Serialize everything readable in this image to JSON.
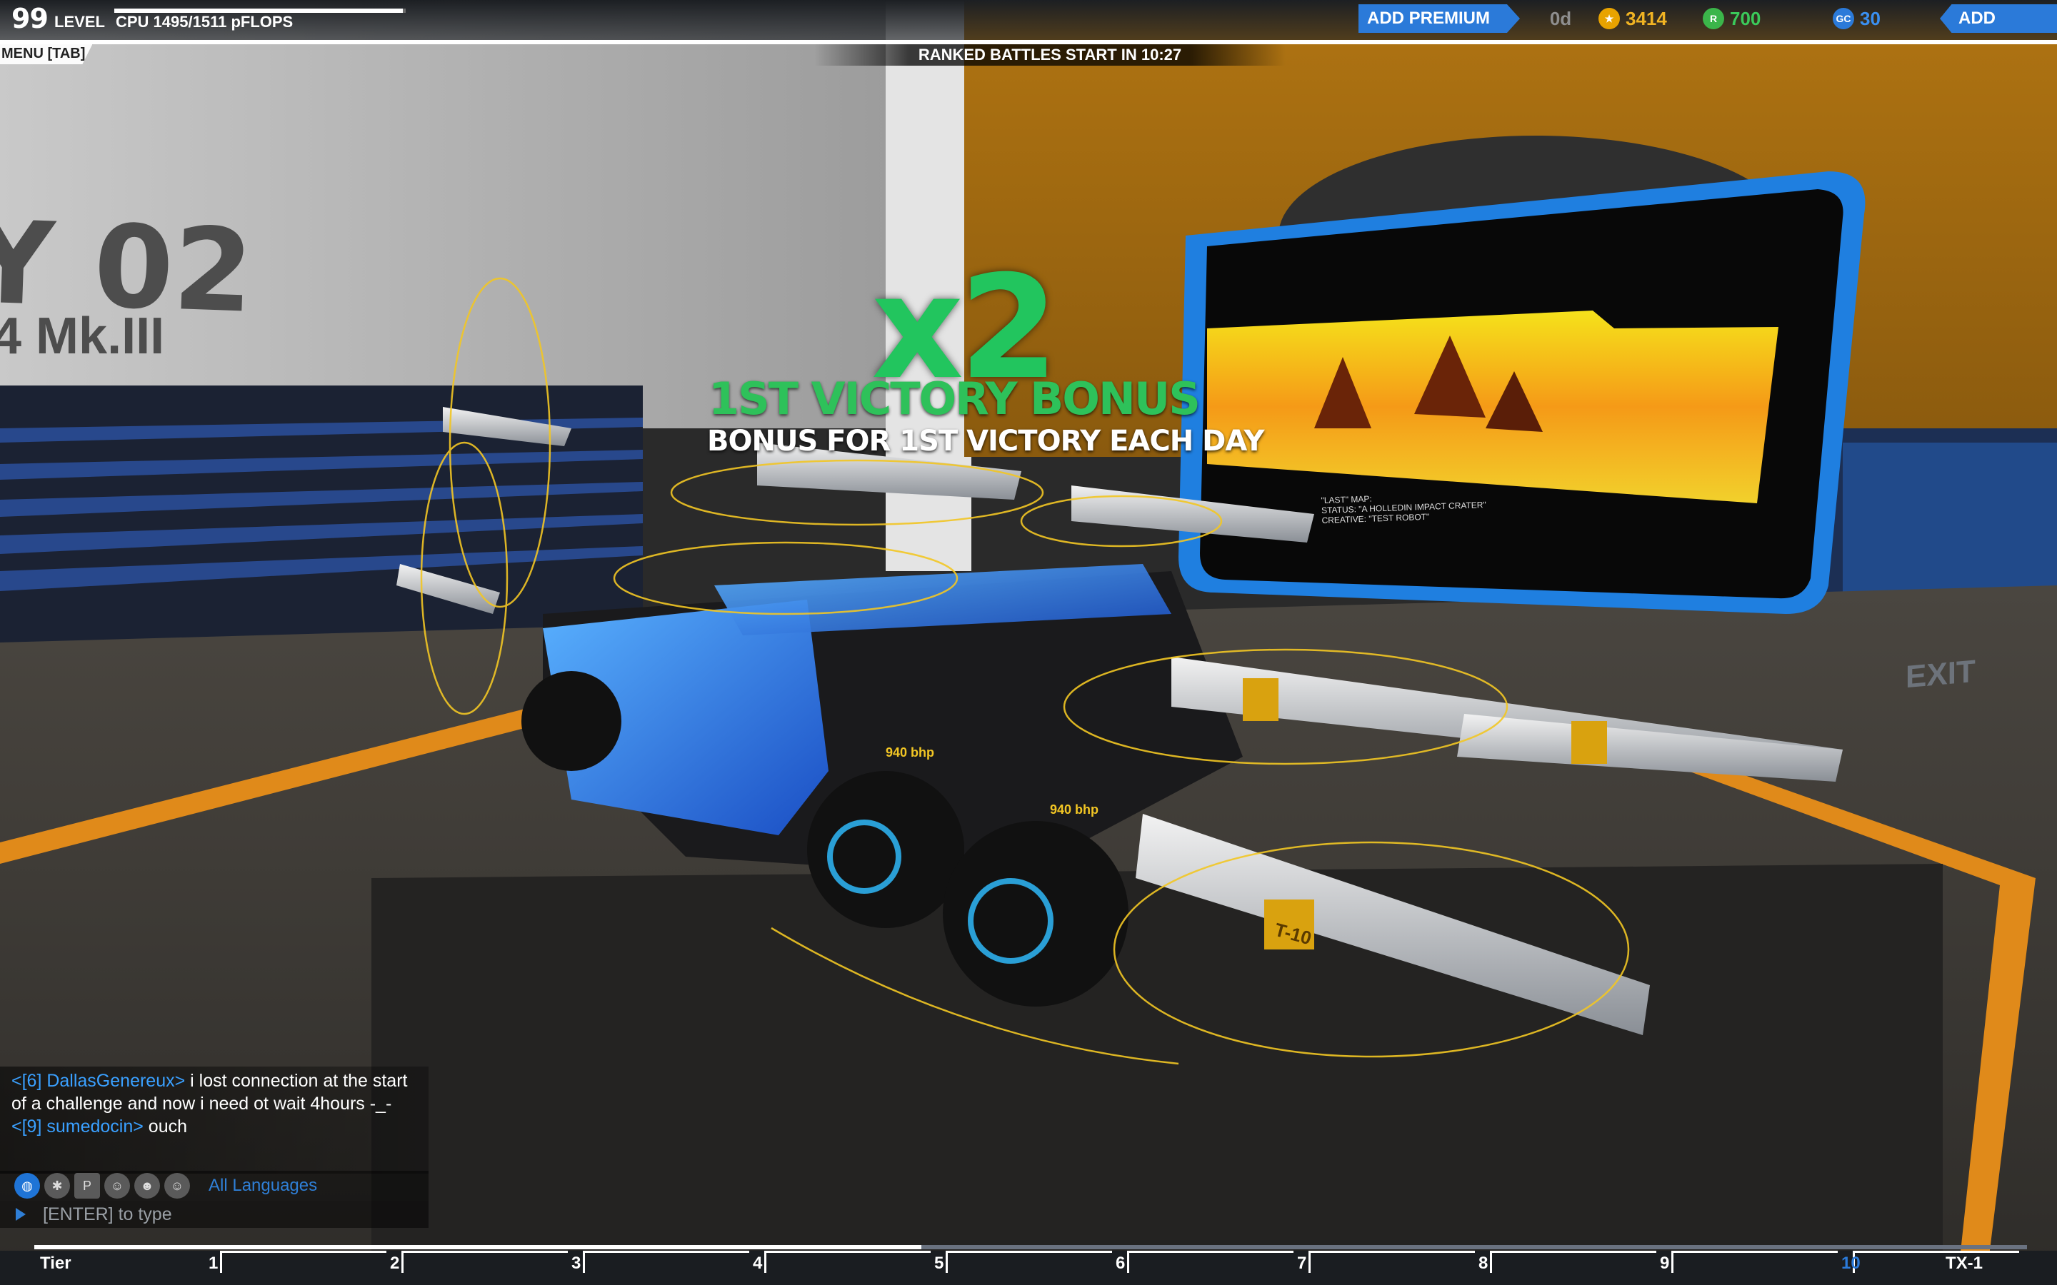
{
  "player": {
    "level_number": "99",
    "level_label": "LEVEL",
    "cpu_text": "CPU 1495/1511 pFLOPS",
    "cpu_fraction": 0.99
  },
  "menu": {
    "label": "MENU [TAB]"
  },
  "ranked": {
    "text": "RANKED BATTLES START IN 10:27"
  },
  "topbar": {
    "add_premium": "ADD PREMIUM",
    "premium_days": "0d",
    "tech_points": "3414",
    "robits": "700",
    "galaxy_coins": "30",
    "add_funds": "ADD FUNDS",
    "colors": {
      "tech": "#e8a300",
      "robits": "#3bb54a",
      "gc": "#2b7ad9"
    }
  },
  "bonus": {
    "multiplier": "x2",
    "title": "1ST VICTORY BONUS",
    "subtitle": "BONUS FOR 1ST VICTORY EACH DAY"
  },
  "background": {
    "garage_bay": "Y 02",
    "garage_sub": "4 Mk.III",
    "exit": "EXIT",
    "screen_lines": [
      "\"LAST\" MAP: ",
      "STATUS: \"A HOLLEDIN IMPACT CRATER\"",
      "CREATIVE: \"TEST ROBOT\""
    ],
    "cannon_label": "T-10",
    "wheel_labels": [
      "940 bhp",
      "940 bhp"
    ]
  },
  "chat": {
    "messages": [
      {
        "name": "<[6] DallasGenereux>",
        "text": " i lost connection at the start of a challenge and now i need ot wait 4hours -_-"
      },
      {
        "name": "<[9] sumedocin>",
        "text": " ouch"
      }
    ],
    "language": "All Languages",
    "input_placeholder": "[ENTER] to type",
    "icons": [
      "globe-icon",
      "accessibility-icon",
      "party-icon",
      "friend-icon",
      "clan-icon",
      "whisper-icon"
    ]
  },
  "tier_bar": {
    "start_label": "Tier",
    "labels": [
      "1",
      "2",
      "3",
      "4",
      "5",
      "6",
      "7",
      "8",
      "9",
      "10",
      "TX-1"
    ],
    "progress": 0.445
  }
}
